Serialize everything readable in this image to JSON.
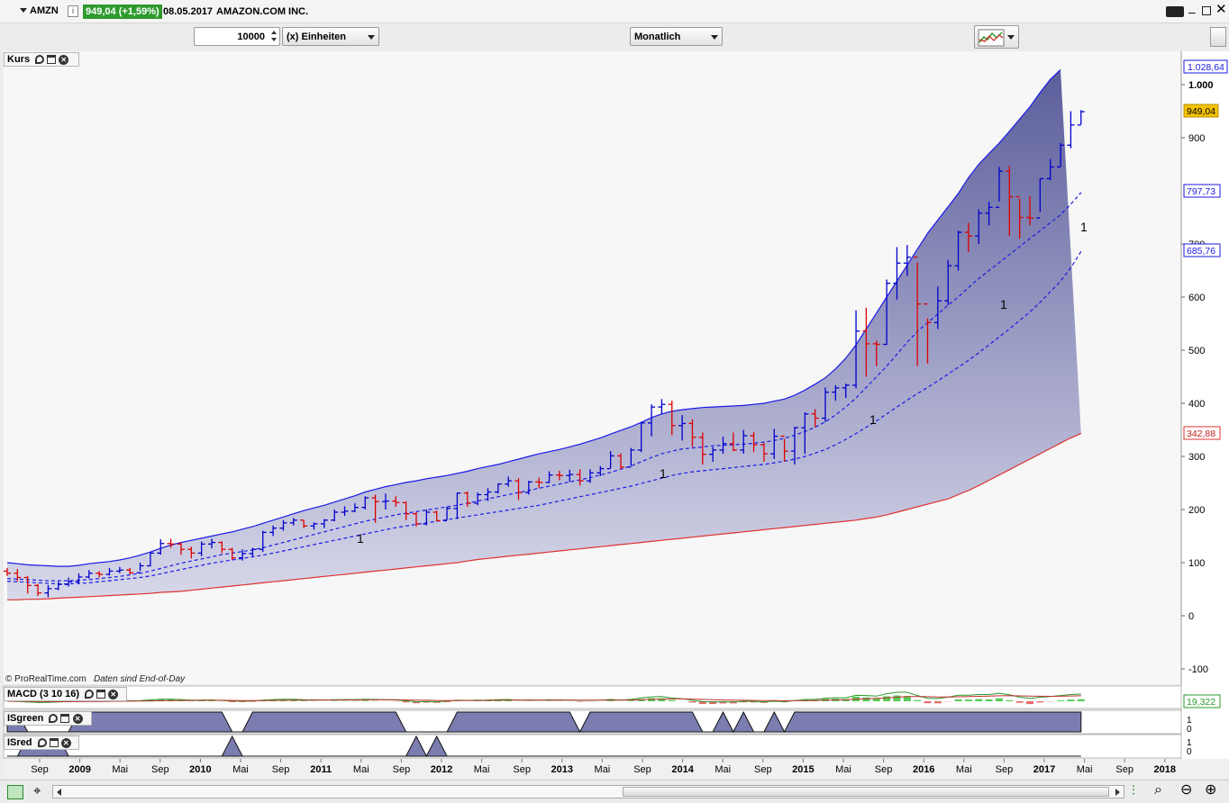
{
  "window": {
    "symbol": "AMZN",
    "price_badge": "949,04 (+1,59%)",
    "date": "08.05.2017",
    "instrument_name": "AMAZON.COM INC."
  },
  "toolbar": {
    "quantity_value": "10000",
    "unit_label": "(x) Einheiten",
    "period_label": "Monatlich"
  },
  "panels": {
    "price_title": "Kurs",
    "macd_title": "MACD (3 10 16)",
    "macd_value_label": "19,322",
    "isgreen_title": "ISgreen",
    "isred_title": "ISred",
    "copyright": "© ProRealTime.com",
    "data_note": "Daten sind End-of-Day"
  },
  "price_axis": {
    "ticks": [
      "1.000",
      "900",
      "700",
      "600",
      "500",
      "400",
      "300",
      "200",
      "100",
      "0",
      "-100"
    ],
    "tick_values": [
      1000,
      900,
      700,
      600,
      500,
      400,
      300,
      200,
      100,
      0,
      -100
    ],
    "upper_band_label": "1.028,64",
    "price_label": "949,04",
    "mid_label": "797,73",
    "lower_label": "685,76",
    "lower_band_label": "342,88"
  },
  "time_axis": {
    "labels": [
      "Sep",
      "2009",
      "Mai",
      "Sep",
      "2010",
      "Mai",
      "Sep",
      "2011",
      "Mai",
      "Sep",
      "2012",
      "Mai",
      "Sep",
      "2013",
      "Mai",
      "Sep",
      "2014",
      "Mai",
      "Sep",
      "2015",
      "Mai",
      "Sep",
      "2016",
      "Mai",
      "Sep",
      "2017",
      "Mai",
      "Sep",
      "2018"
    ]
  },
  "annotations": [
    "1",
    "1",
    "1",
    "1",
    "1"
  ],
  "isgreen_scale": [
    "1",
    "0"
  ],
  "isred_scale": [
    "1",
    "0"
  ],
  "colors": {
    "up_bar": "#0000cc",
    "down_bar": "#dd0000",
    "band_fill": "#6d6fa8",
    "upper_band": "#1a1ae6",
    "lower_band": "#e03030",
    "price_badge_bg": "#2e9a2e",
    "price_label_bg": "#f2c200"
  },
  "chart_data": {
    "type": "ohlc",
    "timeframe": "monthly",
    "ylim": [
      -100,
      1050
    ],
    "x": [
      "2008-08",
      "2008-09",
      "2008-10",
      "2008-11",
      "2008-12",
      "2009-01",
      "2009-02",
      "2009-03",
      "2009-04",
      "2009-05",
      "2009-06",
      "2009-07",
      "2009-08",
      "2009-09",
      "2009-10",
      "2009-11",
      "2009-12",
      "2010-01",
      "2010-02",
      "2010-03",
      "2010-04",
      "2010-05",
      "2010-06",
      "2010-07",
      "2010-08",
      "2010-09",
      "2010-10",
      "2010-11",
      "2010-12",
      "2011-01",
      "2011-02",
      "2011-03",
      "2011-04",
      "2011-05",
      "2011-06",
      "2011-07",
      "2011-08",
      "2011-09",
      "2011-10",
      "2011-11",
      "2011-12",
      "2012-01",
      "2012-02",
      "2012-03",
      "2012-04",
      "2012-05",
      "2012-06",
      "2012-07",
      "2012-08",
      "2012-09",
      "2012-10",
      "2012-11",
      "2012-12",
      "2013-01",
      "2013-02",
      "2013-03",
      "2013-04",
      "2013-05",
      "2013-06",
      "2013-07",
      "2013-08",
      "2013-09",
      "2013-10",
      "2013-11",
      "2013-12",
      "2014-01",
      "2014-02",
      "2014-03",
      "2014-04",
      "2014-05",
      "2014-06",
      "2014-07",
      "2014-08",
      "2014-09",
      "2014-10",
      "2014-11",
      "2014-12",
      "2015-01",
      "2015-02",
      "2015-03",
      "2015-04",
      "2015-05",
      "2015-06",
      "2015-07",
      "2015-08",
      "2015-09",
      "2015-10",
      "2015-11",
      "2015-12",
      "2016-01",
      "2016-02",
      "2016-03",
      "2016-04",
      "2016-05",
      "2016-06",
      "2016-07",
      "2016-08",
      "2016-09",
      "2016-10",
      "2016-11",
      "2016-12",
      "2017-01",
      "2017-02",
      "2017-03",
      "2017-04",
      "2017-05"
    ],
    "close": [
      80,
      72,
      57,
      43,
      51,
      59,
      64,
      73,
      80,
      78,
      84,
      86,
      81,
      94,
      118,
      136,
      135,
      125,
      118,
      135,
      138,
      125,
      109,
      117,
      125,
      157,
      165,
      175,
      180,
      169,
      173,
      180,
      195,
      197,
      204,
      222,
      215,
      216,
      213,
      192,
      173,
      195,
      179,
      202,
      231,
      212,
      228,
      233,
      248,
      254,
      232,
      252,
      251,
      265,
      264,
      266,
      254,
      269,
      277,
      301,
      280,
      312,
      363,
      393,
      398,
      358,
      362,
      336,
      304,
      312,
      324,
      312,
      339,
      322,
      305,
      338,
      310,
      354,
      380,
      372,
      421,
      429,
      434,
      536,
      512,
      511,
      626,
      664,
      675,
      587,
      552,
      593,
      659,
      722,
      715,
      758,
      769,
      837,
      789,
      750,
      749,
      823,
      845,
      886,
      924,
      949
    ],
    "high": [
      90,
      88,
      75,
      60,
      58,
      64,
      72,
      80,
      86,
      84,
      90,
      92,
      90,
      100,
      120,
      144,
      145,
      138,
      130,
      140,
      145,
      140,
      128,
      125,
      128,
      160,
      170,
      180,
      184,
      180,
      176,
      182,
      200,
      206,
      212,
      225,
      228,
      230,
      225,
      215,
      195,
      200,
      198,
      205,
      232,
      234,
      232,
      240,
      249,
      262,
      259,
      254,
      260,
      272,
      273,
      275,
      276,
      276,
      282,
      310,
      306,
      316,
      365,
      398,
      408,
      405,
      378,
      370,
      345,
      318,
      337,
      345,
      350,
      346,
      325,
      352,
      333,
      356,
      383,
      389,
      430,
      434,
      437,
      575,
      580,
      518,
      633,
      694,
      698,
      665,
      560,
      620,
      670,
      725,
      740,
      765,
      780,
      845,
      847,
      785,
      790,
      823,
      860,
      890,
      950,
      952
    ],
    "low": [
      75,
      65,
      42,
      37,
      35,
      48,
      55,
      60,
      70,
      72,
      76,
      80,
      78,
      84,
      93,
      115,
      128,
      115,
      108,
      112,
      127,
      118,
      105,
      104,
      112,
      120,
      150,
      160,
      170,
      165,
      162,
      165,
      178,
      188,
      195,
      200,
      175,
      200,
      205,
      180,
      168,
      170,
      178,
      180,
      182,
      205,
      208,
      216,
      230,
      243,
      218,
      228,
      240,
      250,
      255,
      252,
      245,
      250,
      263,
      278,
      276,
      282,
      308,
      338,
      380,
      340,
      330,
      318,
      285,
      290,
      305,
      310,
      305,
      308,
      290,
      295,
      290,
      285,
      305,
      355,
      365,
      405,
      410,
      428,
      450,
      470,
      510,
      595,
      640,
      470,
      475,
      540,
      585,
      650,
      685,
      700,
      735,
      780,
      715,
      710,
      735,
      760,
      820,
      845,
      880,
      925
    ],
    "upper_band": [
      100,
      98,
      96,
      95,
      94,
      93,
      93,
      95,
      98,
      100,
      102,
      105,
      109,
      114,
      120,
      127,
      133,
      138,
      142,
      146,
      150,
      154,
      158,
      163,
      168,
      174,
      180,
      186,
      192,
      198,
      203,
      208,
      214,
      220,
      226,
      233,
      238,
      243,
      247,
      251,
      254,
      258,
      261,
      264,
      268,
      272,
      277,
      281,
      285,
      290,
      295,
      300,
      305,
      309,
      313,
      318,
      323,
      329,
      335,
      342,
      349,
      356,
      364,
      373,
      380,
      385,
      388,
      390,
      392,
      393,
      394,
      395,
      396,
      398,
      400,
      404,
      408,
      415,
      425,
      436,
      448,
      465,
      485,
      510,
      540,
      570,
      600,
      630,
      660,
      690,
      720,
      745,
      770,
      795,
      825,
      850,
      870,
      890,
      912,
      935,
      958,
      985,
      1010,
      1028
    ],
    "lower_band": [
      30,
      30,
      31,
      31,
      32,
      33,
      34,
      35,
      36,
      37,
      38,
      39,
      40,
      41,
      42,
      44,
      45,
      46,
      48,
      50,
      52,
      54,
      56,
      58,
      60,
      62,
      64,
      66,
      68,
      70,
      72,
      74,
      76,
      78,
      80,
      82,
      84,
      86,
      88,
      90,
      92,
      94,
      96,
      98,
      100,
      103,
      106,
      108,
      110,
      112,
      114,
      116,
      118,
      120,
      122,
      124,
      126,
      128,
      130,
      132,
      134,
      136,
      138,
      140,
      142,
      144,
      146,
      148,
      150,
      152,
      154,
      156,
      158,
      160,
      162,
      164,
      166,
      168,
      170,
      172,
      174,
      176,
      178,
      180,
      183,
      186,
      190,
      195,
      200,
      205,
      210,
      215,
      220,
      228,
      236,
      245,
      255,
      265,
      275,
      285,
      295,
      305,
      315,
      325,
      335,
      343
    ],
    "mid_line_upper": [
      70,
      69,
      68,
      67,
      66,
      66,
      66,
      67,
      68,
      70,
      72,
      74,
      77,
      80,
      84,
      89,
      94,
      99,
      103,
      107,
      111,
      115,
      118,
      121,
      124,
      128,
      133,
      138,
      143,
      148,
      153,
      158,
      163,
      168,
      173,
      178,
      182,
      186,
      190,
      193,
      196,
      199,
      202,
      205,
      208,
      212,
      216,
      220,
      224,
      228,
      232,
      236,
      240,
      244,
      248,
      252,
      256,
      260,
      265,
      270,
      276,
      282,
      290,
      298,
      305,
      310,
      314,
      316,
      318,
      320,
      321,
      322,
      323,
      325,
      327,
      330,
      334,
      340,
      347,
      355,
      365,
      378,
      393,
      410,
      430,
      450,
      470,
      492,
      515,
      535,
      552,
      568,
      585,
      600,
      618,
      635,
      650,
      665,
      680,
      695,
      710,
      725,
      740,
      755,
      775,
      797
    ],
    "mid_line_lower": [
      65,
      64,
      63,
      62,
      61,
      60,
      60,
      61,
      62,
      64,
      66,
      68,
      70,
      72,
      75,
      79,
      83,
      87,
      91,
      95,
      99,
      102,
      105,
      108,
      111,
      114,
      118,
      122,
      126,
      130,
      134,
      138,
      142,
      146,
      150,
      154,
      158,
      162,
      166,
      169,
      172,
      175,
      178,
      181,
      184,
      187,
      190,
      193,
      196,
      199,
      202,
      205,
      208,
      212,
      216,
      220,
      224,
      228,
      232,
      236,
      240,
      244,
      249,
      254,
      259,
      264,
      268,
      271,
      273,
      275,
      277,
      279,
      281,
      283,
      285,
      288,
      291,
      295,
      300,
      306,
      313,
      322,
      332,
      343,
      355,
      367,
      380,
      393,
      406,
      418,
      430,
      442,
      455,
      468,
      481,
      495,
      510,
      525,
      540,
      556,
      572,
      590,
      610,
      630,
      655,
      686
    ]
  }
}
